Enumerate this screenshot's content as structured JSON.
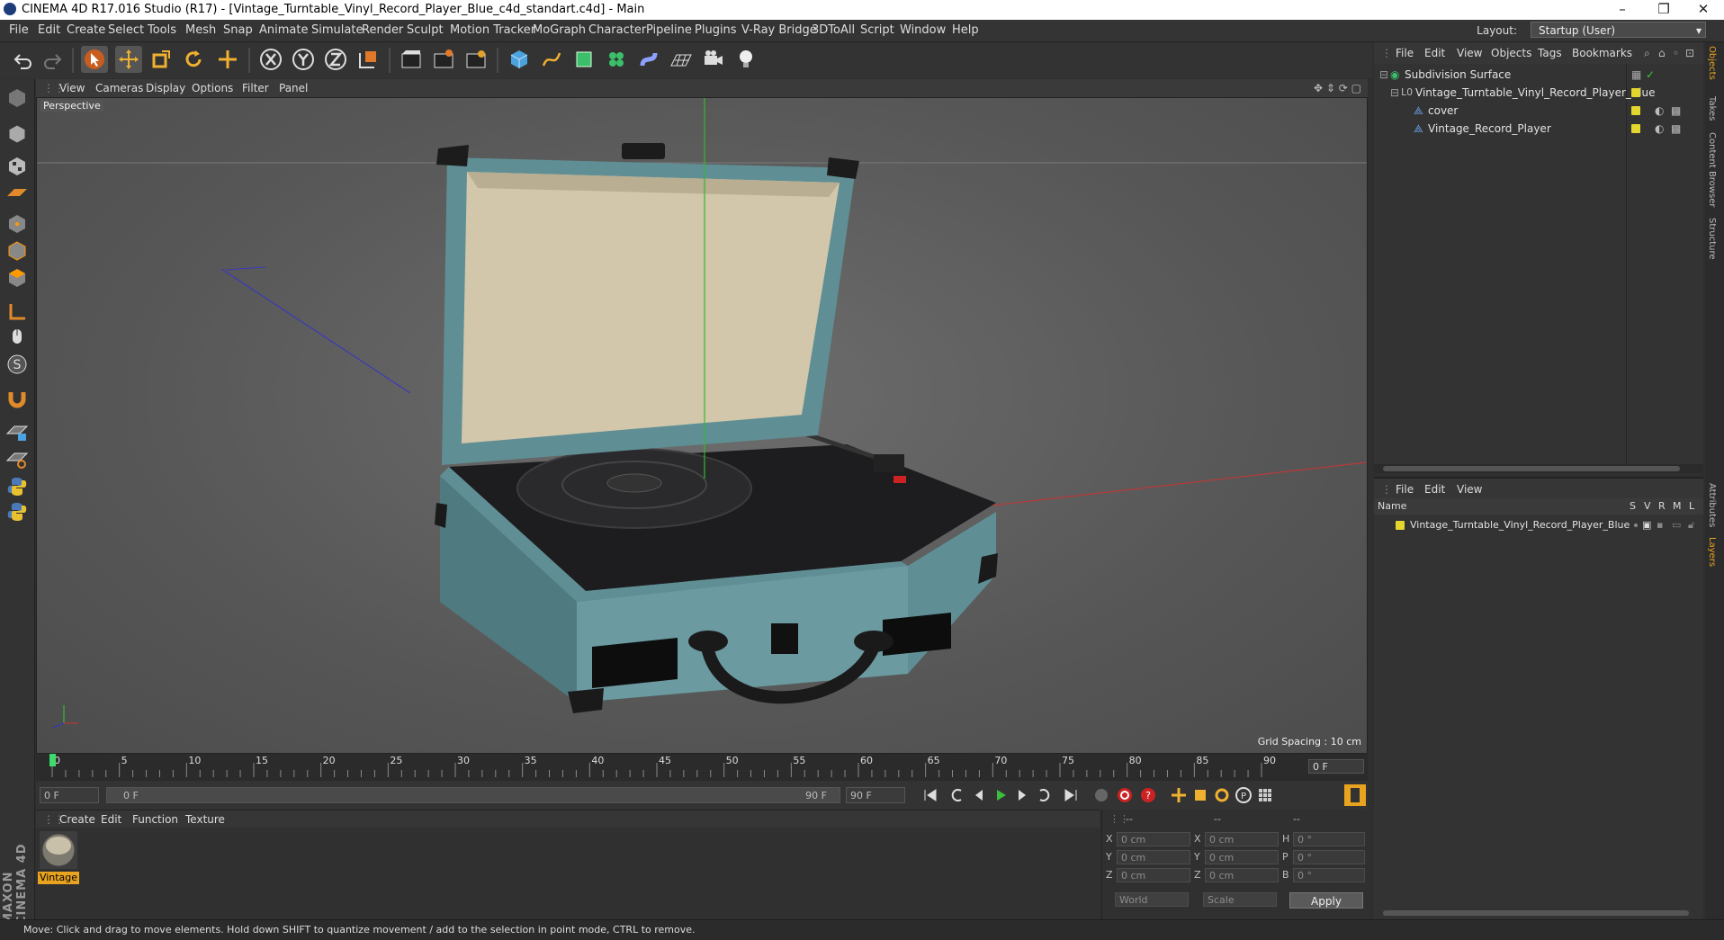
{
  "window": {
    "title": "CINEMA 4D R17.016 Studio (R17) - [Vintage_Turntable_Vinyl_Record_Player_Blue_c4d_standart.c4d] - Main",
    "controls": [
      "–",
      "❐",
      "✕"
    ]
  },
  "menubar": {
    "items": [
      "File",
      "Edit",
      "Create",
      "Select",
      "Tools",
      "Mesh",
      "Snap",
      "Animate",
      "Simulate",
      "Render",
      "Sculpt",
      "Motion Tracker",
      "MoGraph",
      "Character",
      "Pipeline",
      "Plugins",
      "V-Ray Bridge",
      "3DToAll",
      "Script",
      "Window",
      "Help"
    ],
    "layout_label": "Layout:",
    "layout_value": "Startup (User)"
  },
  "toolbar": {
    "icons": [
      "undo-icon",
      "redo-icon",
      "select-arrow-icon",
      "move-icon",
      "scale-icon",
      "rotate-icon",
      "move-last-icon",
      "x-axis-icon",
      "y-axis-icon",
      "z-axis-icon",
      "world-coords-icon",
      "render-view-icon",
      "render-picture-viewer-icon",
      "edit-render-settings-icon",
      "cube-icon",
      "pen-spline-icon",
      "subdivision-icon",
      "mograph-cloner-icon",
      "deformer-icon",
      "floor-icon",
      "camera-icon",
      "light-icon"
    ]
  },
  "viewport": {
    "menu": [
      "View",
      "Cameras",
      "Display",
      "Options",
      "Filter",
      "Panel"
    ],
    "label": "Perspective",
    "grid_spacing": "Grid Spacing : 10 cm"
  },
  "timeline": {
    "ticks": [
      "0",
      "5",
      "10",
      "15",
      "20",
      "25",
      "30",
      "35",
      "40",
      "45",
      "50",
      "55",
      "60",
      "65",
      "70",
      "75",
      "80",
      "85",
      "90"
    ],
    "current_frame": "0 F"
  },
  "transport": {
    "start_field": "0 F",
    "range_start": "0 F",
    "range_end": "90 F",
    "end_field": "90 F"
  },
  "materials": {
    "menu": [
      "Create",
      "Edit",
      "Function",
      "Texture"
    ],
    "items": [
      {
        "name": "Vintage"
      }
    ]
  },
  "coordinates": {
    "headers": [
      "--",
      "--",
      "--"
    ],
    "rows": [
      {
        "axis": "X",
        "pos": "0 cm",
        "size_axis": "X",
        "size": "0 cm",
        "rot_axis": "H",
        "rot": "0 °"
      },
      {
        "axis": "Y",
        "pos": "0 cm",
        "size_axis": "Y",
        "size": "0 cm",
        "rot_axis": "P",
        "rot": "0 °"
      },
      {
        "axis": "Z",
        "pos": "0 cm",
        "size_axis": "Z",
        "size": "0 cm",
        "rot_axis": "B",
        "rot": "0 °"
      }
    ],
    "mode_world": "World",
    "mode_scale": "Scale",
    "apply_label": "Apply"
  },
  "status": {
    "text": "Move: Click and drag to move elements. Hold down SHIFT to quantize movement / add to the selection in point mode, CTRL to remove."
  },
  "objects_panel": {
    "menu": [
      "File",
      "Edit",
      "View",
      "Objects",
      "Tags",
      "Bookmarks"
    ],
    "tree": [
      {
        "name": "Subdivision Surface",
        "level": 0
      },
      {
        "name": "Vintage_Turntable_Vinyl_Record_Player_Blue",
        "level": 1
      },
      {
        "name": "cover",
        "level": 2
      },
      {
        "name": "Vintage_Record_Player",
        "level": 2
      }
    ]
  },
  "layers_panel": {
    "menu": [
      "File",
      "Edit",
      "View"
    ],
    "columns": [
      "Name",
      "S",
      "V",
      "R",
      "M",
      "L"
    ],
    "rows": [
      {
        "name": "Vintage_Turntable_Vinyl_Record_Player_Blue"
      }
    ]
  },
  "right_tabs": [
    "Objects",
    "Takes",
    "Content Browser",
    "Structure",
    "Attributes",
    "Layers"
  ],
  "brand": {
    "vertical_logo": "MAXON CINEMA 4D"
  },
  "colors": {
    "accent_orange": "#e8a31f",
    "layer_yellow": "#e3d62e",
    "axis_red": "#c33",
    "axis_green": "#3c3",
    "axis_blue": "#33c"
  }
}
